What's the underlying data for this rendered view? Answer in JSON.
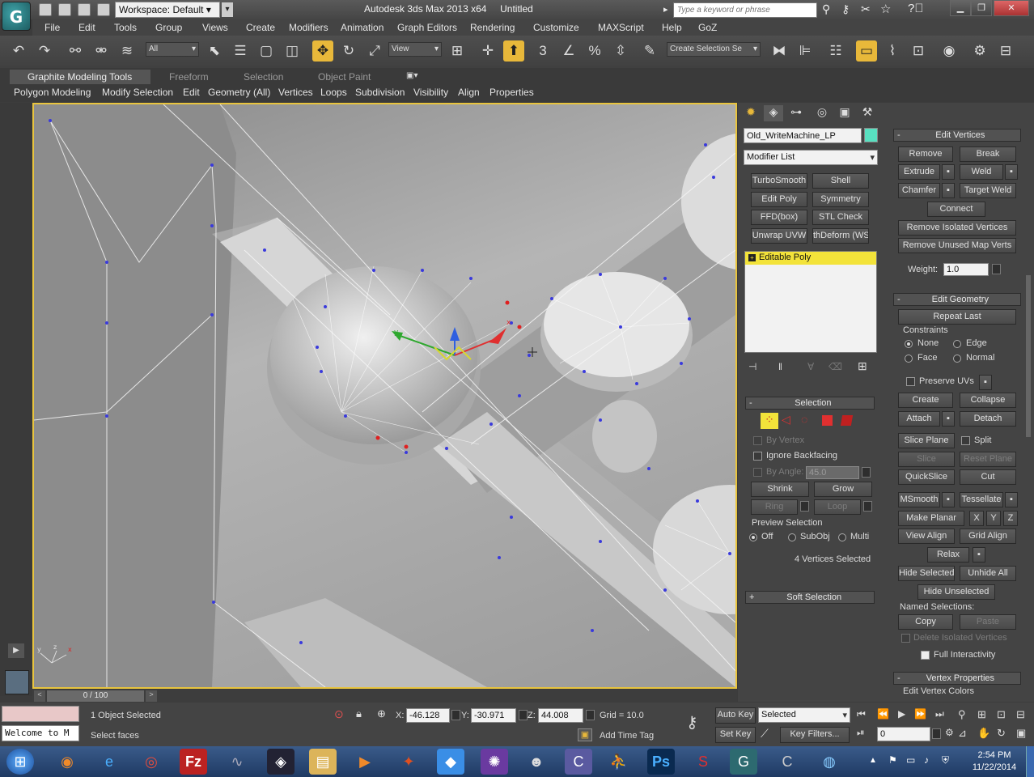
{
  "title": {
    "workspace": "Workspace: Default",
    "app": "Autodesk 3ds Max  2013 x64",
    "file": "Untitled",
    "search_placeholder": "Type a keyword or phrase"
  },
  "menu": [
    "File",
    "Edit",
    "Tools",
    "Group",
    "Views",
    "Create",
    "Modifiers",
    "Animation",
    "Graph Editors",
    "Rendering",
    "Customize",
    "MAXScript",
    "Help",
    "GoZ"
  ],
  "toolbar": {
    "filter": "All",
    "coord": "View",
    "selset": "Create Selection Se",
    "snap_num": "3",
    "angle_num": "%"
  },
  "ribbon": {
    "tabs": [
      "Graphite Modeling Tools",
      "Freeform",
      "Selection",
      "Object Paint"
    ],
    "sub": [
      "Polygon Modeling",
      "Modify Selection",
      "Edit",
      "Geometry (All)",
      "Vertices",
      "Loops",
      "Subdivision",
      "Visibility",
      "Align",
      "Properties"
    ]
  },
  "modifier_panel": {
    "object_name": "Old_WriteMachine_LP",
    "object_color": "#58e0c0",
    "modifier_list": "Modifier List",
    "buttons": [
      [
        "TurboSmooth",
        "Shell"
      ],
      [
        "Edit Poly",
        "Symmetry"
      ],
      [
        "FFD(box)",
        "STL Check"
      ],
      [
        "Unwrap UVW",
        "thDeform (WSI"
      ]
    ],
    "stack_item": "Editable Poly"
  },
  "selection": {
    "header": "Selection",
    "by_vertex": "By Vertex",
    "ignore_backfacing": "Ignore Backfacing",
    "by_angle": "By Angle:",
    "angle_val": "45.0",
    "shrink": "Shrink",
    "grow": "Grow",
    "ring": "Ring",
    "loop": "Loop",
    "preview": "Preview Selection",
    "off": "Off",
    "subobj": "SubObj",
    "multi": "Multi",
    "status": "4 Vertices Selected",
    "soft": "Soft Selection"
  },
  "edit_vertices": {
    "header": "Edit Vertices",
    "remove": "Remove",
    "break": "Break",
    "extrude": "Extrude",
    "weld": "Weld",
    "chamfer": "Chamfer",
    "target_weld": "Target Weld",
    "connect": "Connect",
    "remove_isolated": "Remove Isolated Vertices",
    "remove_unused": "Remove Unused Map Verts",
    "weight_label": "Weight:",
    "weight": "1.0"
  },
  "edit_geometry": {
    "header": "Edit Geometry",
    "repeat": "Repeat Last",
    "constraints": "Constraints",
    "none": "None",
    "edge": "Edge",
    "face": "Face",
    "normal": "Normal",
    "preserve": "Preserve UVs",
    "create": "Create",
    "collapse": "Collapse",
    "attach": "Attach",
    "detach": "Detach",
    "slice_plane": "Slice Plane",
    "split": "Split",
    "slice": "Slice",
    "reset_plane": "Reset Plane",
    "quickslice": "QuickSlice",
    "cut": "Cut",
    "msmooth": "MSmooth",
    "tessellate": "Tessellate",
    "make_planar": "Make Planar",
    "x": "X",
    "y": "Y",
    "z": "Z",
    "view_align": "View Align",
    "grid_align": "Grid Align",
    "relax": "Relax",
    "hide_selected": "Hide Selected",
    "unhide_all": "Unhide All",
    "hide_unselected": "Hide Unselected",
    "named": "Named Selections:",
    "copy": "Copy",
    "paste": "Paste",
    "delete_isolated": "Delete Isolated Vertices",
    "full_interactivity": "Full Interactivity"
  },
  "vertex_properties": {
    "header": "Vertex Properties",
    "colors": "Edit Vertex Colors"
  },
  "viewport": {
    "axis": [
      "x",
      "y",
      "z"
    ]
  },
  "timeline": {
    "frame": "0 / 100"
  },
  "status": {
    "maxscript": "Welcome to M",
    "objects": "1 Object Selected",
    "prompt": "Select faces",
    "x_label": "X:",
    "x": "-46.128",
    "y_label": "Y:",
    "y": "-30.971",
    "z_label": "Z:",
    "z": "44.008",
    "grid": "Grid = 10.0",
    "add_time_tag": "Add Time Tag",
    "auto_key": "Auto Key",
    "set_key": "Set Key",
    "selected": "Selected",
    "key_filters": "Key Filters...",
    "frame_field": "0"
  },
  "taskbar": {
    "time": "2:54 PM",
    "date": "11/22/2014"
  }
}
